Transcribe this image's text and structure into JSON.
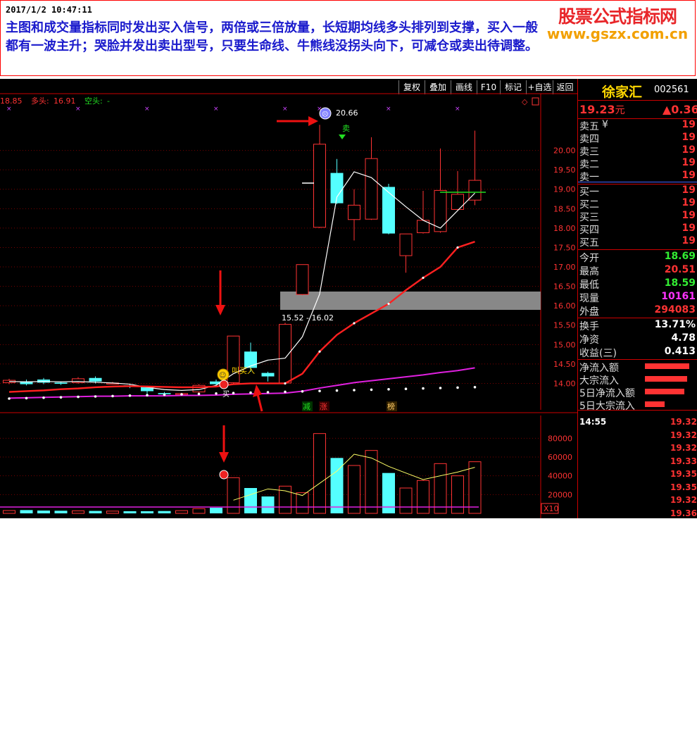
{
  "annotation": {
    "timestamp": "2017/1/2 10:47:11",
    "text": "主图和成交量指标同时发出买入信号，两倍或三倍放量，长短期均线多头排列到支撑，买入一般都有一波主升；哭脸并发出卖出型号，只要生命线、牛熊线没拐头向下，可减仓或卖出待调整。"
  },
  "watermark": {
    "line1": "股票公式指标网",
    "line2": "www.gszx.com.cn"
  },
  "toolbar": {
    "items": [
      "复权",
      "叠加",
      "画线",
      "F10",
      "标记",
      "+自选",
      "返回"
    ]
  },
  "indicator": {
    "v1": "18.85",
    "duo_label": "多头:",
    "duo": "16.91",
    "kong_label": "空头:",
    "kong": "-"
  },
  "chart_labels": {
    "zone": "15.52 - 16.02",
    "peak": "20.66",
    "sell": "卖",
    "buy": "买",
    "buy_text": "叫买入",
    "tag_jian": "减",
    "tag_zhang": "涨",
    "tag_bang": "榜",
    "vol_multiplier": "X10"
  },
  "colors": {
    "up": "#ff3333",
    "down": "#54ffff",
    "ma_white": "#ffffff",
    "ma_red": "#ff2020",
    "ma_magenta": "#e020e0",
    "accent_red": "#e8262a"
  },
  "chart_data": {
    "type": "candlestick",
    "price_axis": {
      "min": 13.7,
      "max": 20.7,
      "ticks": [
        "20.00",
        "19.50",
        "19.00",
        "18.50",
        "18.00",
        "17.50",
        "17.00",
        "16.50",
        "16.00",
        "15.50",
        "15.00",
        "14.50",
        "14.00"
      ]
    },
    "volume_axis": {
      "max": 90000,
      "ticks": [
        "80000",
        "60000",
        "40000",
        "20000"
      ]
    },
    "candles": [
      {
        "o": 14.02,
        "c": 14.08,
        "h": 14.12,
        "l": 13.98
      },
      {
        "o": 14.05,
        "c": 13.98,
        "h": 14.1,
        "l": 13.95
      },
      {
        "o": 14.1,
        "c": 14.02,
        "h": 14.14,
        "l": 13.98
      },
      {
        "o": 14.02,
        "c": 13.99,
        "h": 14.05,
        "l": 13.96
      },
      {
        "o": 14.02,
        "c": 14.12,
        "h": 14.16,
        "l": 13.99
      },
      {
        "o": 14.14,
        "c": 14.05,
        "h": 14.18,
        "l": 14.0
      },
      {
        "o": 14.0,
        "c": 14.01,
        "h": 14.04,
        "l": 13.98
      },
      {
        "o": 13.95,
        "c": 13.91,
        "h": 13.98,
        "l": 13.88
      },
      {
        "o": 13.92,
        "c": 13.8,
        "h": 13.94,
        "l": 13.73
      },
      {
        "o": 13.75,
        "c": 13.72,
        "h": 13.78,
        "l": 13.7
      },
      {
        "o": 13.73,
        "c": 13.74,
        "h": 13.76,
        "l": 13.71
      },
      {
        "o": 13.78,
        "c": 13.95,
        "h": 13.98,
        "l": 13.75
      },
      {
        "o": 14.05,
        "c": 13.98,
        "h": 14.1,
        "l": 13.96
      },
      {
        "o": 14.02,
        "c": 15.22,
        "h": 15.22,
        "l": 14.0
      },
      {
        "o": 14.82,
        "c": 14.4,
        "h": 15.05,
        "l": 14.3
      },
      {
        "o": 14.27,
        "c": 14.18,
        "h": 14.3,
        "l": 14.05
      },
      {
        "o": 14.01,
        "c": 15.52,
        "h": 15.56,
        "l": 13.97
      },
      {
        "o": 16.29,
        "c": 17.06,
        "h": 17.06,
        "l": 16.27
      },
      {
        "o": 18.02,
        "c": 20.16,
        "h": 20.66,
        "l": 18.0
      },
      {
        "o": 19.42,
        "c": 18.64,
        "h": 19.78,
        "l": 18.62
      },
      {
        "o": 18.22,
        "c": 18.59,
        "h": 19.0,
        "l": 17.68
      },
      {
        "o": 18.23,
        "c": 19.79,
        "h": 20.34,
        "l": 18.21
      },
      {
        "o": 19.06,
        "c": 17.86,
        "h": 19.14,
        "l": 17.84
      },
      {
        "o": 17.29,
        "c": 17.85,
        "h": 17.85,
        "l": 16.85
      },
      {
        "o": 17.88,
        "c": 18.2,
        "h": 18.96,
        "l": 17.86
      },
      {
        "o": 17.91,
        "c": 18.97,
        "h": 20.05,
        "l": 17.88
      },
      {
        "o": 18.48,
        "c": 18.87,
        "h": 19.47,
        "l": 18.46
      },
      {
        "o": 18.72,
        "c": 19.23,
        "h": 20.51,
        "l": 18.59
      }
    ],
    "ma_white": [
      14.05,
      14.04,
      14.05,
      14.04,
      14.05,
      14.03,
      14.01,
      13.98,
      13.9,
      13.84,
      13.82,
      13.84,
      13.95,
      14.25,
      14.45,
      14.6,
      14.65,
      15.2,
      16.3,
      18.8,
      19.45,
      19.3,
      18.92,
      18.55,
      18.2,
      18.0,
      18.45,
      18.9
    ],
    "ma_red": [
      13.78,
      13.8,
      13.82,
      13.85,
      13.87,
      13.9,
      13.92,
      13.93,
      13.92,
      13.91,
      13.9,
      13.9,
      13.92,
      13.98,
      14.0,
      14.0,
      14.0,
      14.25,
      14.82,
      15.25,
      15.55,
      15.8,
      16.05,
      16.4,
      16.72,
      17.0,
      17.5,
      17.65
    ],
    "ma_magenta": [
      13.62,
      13.63,
      13.64,
      13.65,
      13.66,
      13.67,
      13.67,
      13.68,
      13.68,
      13.68,
      13.69,
      13.69,
      13.7,
      13.72,
      13.73,
      13.74,
      13.75,
      13.8,
      13.88,
      13.95,
      14.02,
      14.07,
      14.12,
      14.17,
      14.22,
      14.28,
      14.33,
      14.4
    ],
    "volume": [
      3000,
      3500,
      3000,
      2800,
      2700,
      2600,
      2400,
      2300,
      2300,
      2500,
      2900,
      5000,
      6000,
      38000,
      27000,
      18000,
      29000,
      22000,
      85000,
      59000,
      51000,
      67000,
      43000,
      27000,
      35000,
      53000,
      40000,
      55000
    ],
    "vol_ma": [
      null,
      null,
      null,
      null,
      null,
      null,
      null,
      null,
      null,
      null,
      null,
      null,
      null,
      14000,
      20000,
      26000,
      24000,
      19000,
      32000,
      45000,
      63000,
      59000,
      50000,
      43000,
      36000,
      40000,
      44000,
      49000
    ]
  },
  "quote": {
    "name": "徐家汇",
    "code": "002561",
    "price": "19.23",
    "price_unit": "元",
    "change": "▲0.36",
    "order_book": [
      {
        "label": "卖五",
        "value": "19",
        "extra": "¥"
      },
      {
        "label": "卖四",
        "value": "19",
        "extra": ""
      },
      {
        "label": "卖三",
        "value": "19",
        "extra": ""
      },
      {
        "label": "卖二",
        "value": "19",
        "extra": ""
      },
      {
        "label": "卖一",
        "value": "19",
        "extra": ""
      },
      {
        "label": "买一",
        "value": "19",
        "extra": ""
      },
      {
        "label": "买二",
        "value": "19",
        "extra": ""
      },
      {
        "label": "买三",
        "value": "19",
        "extra": ""
      },
      {
        "label": "买四",
        "value": "19",
        "extra": ""
      },
      {
        "label": "买五",
        "value": "19",
        "extra": ""
      }
    ],
    "stats": [
      {
        "label": "今开",
        "value": "18.69"
      },
      {
        "label": "最高",
        "value": "20.51"
      },
      {
        "label": "最低",
        "value": "18.59"
      },
      {
        "label": "现量",
        "value": "10161"
      },
      {
        "label": "外盘",
        "value": "294083"
      }
    ],
    "stats2": [
      {
        "label": "换手",
        "value": "13.71%"
      },
      {
        "label": "净资",
        "value": "4.78"
      },
      {
        "label": "收益(三)",
        "value": "0.413"
      }
    ],
    "flows": [
      {
        "label": "净流入额",
        "level": 0.9
      },
      {
        "label": "大宗流入",
        "level": 0.85
      },
      {
        "label": "5日净流入额",
        "level": 0.8
      },
      {
        "label": "5日大宗流入",
        "level": 0.4
      }
    ],
    "ticks": {
      "time": "14:55",
      "rows": [
        "19.32",
        "19.32",
        "19.32",
        "19.33",
        "19.35",
        "19.35",
        "19.32",
        "19.36"
      ]
    }
  }
}
